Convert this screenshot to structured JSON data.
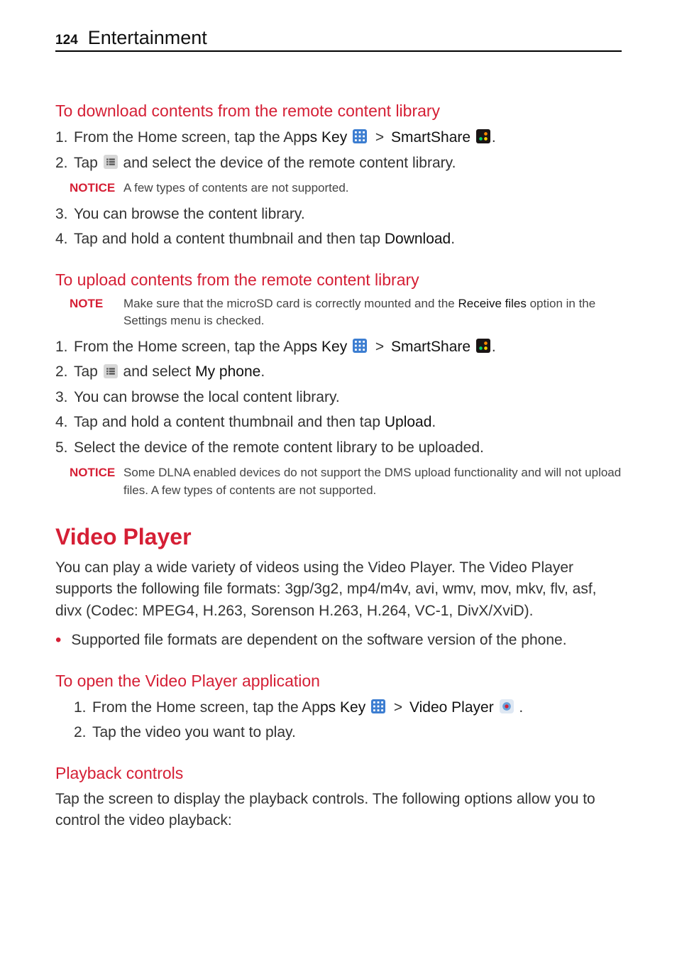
{
  "header": {
    "page_number": "124",
    "title": "Entertainment"
  },
  "sec_download": {
    "heading": "To download contents from the remote content library",
    "step1_a": "From the Home screen, tap the Ap",
    "step1_b": "ps Key",
    "step1_c": "SmartShare",
    "step2_a": "Tap ",
    "step2_b": " and select the device of the remote content library.",
    "notice_label": "NOTICE",
    "notice_text": "A few types of contents are not supported.",
    "step3": "You can browse the content library.",
    "step4_a": "Tap and hold a content thumbnail and then tap ",
    "step4_b": "Download",
    "step4_c": "."
  },
  "sec_upload": {
    "heading": "To upload contents from the remote content library",
    "note_label": "NOTE",
    "note_text_a": "Make sure that the microSD card is correctly mounted and the ",
    "note_text_b": "Receive files",
    "note_text_c": " option in the Settings menu is checked.",
    "step1_a": "From the Home screen, tap the Ap",
    "step1_b": "ps Key",
    "step1_c": "SmartShare",
    "step2_a": "Tap ",
    "step2_b": " and select ",
    "step2_c": "My phone",
    "step2_d": ".",
    "step3": "You can browse the local content library.",
    "step4_a": "Tap and hold a content thumbnail and then tap ",
    "step4_b": "Upload",
    "step4_c": ".",
    "step5": "Select the device of the remote content library to be uploaded.",
    "notice_label": "NOTICE",
    "notice_text": "Some DLNA enabled devices do not support the DMS upload functionality and will not upload files. A few types of contents are not supported."
  },
  "sec_video": {
    "title": "Video Player",
    "intro": "You can play a wide variety of videos using the Video Player. The Video Player supports the following file formats: 3gp/3g2, mp4/m4v, avi, wmv, mov, mkv, flv, asf, divx (Codec: MPEG4, H.263, Sorenson H.263, H.264, VC-1, DivX/XviD).",
    "bullet1": "Supported file formats are dependent on the software version of the phone.",
    "open_heading": "To open the Video Player application",
    "open_step1_a": "From the Home screen, tap the Ap",
    "open_step1_b": "ps Key",
    "open_step1_c": "Video Player",
    "open_step2": "Tap the video you want to play.",
    "playback_heading": "Playback controls",
    "playback_text": "Tap the screen to display the playback controls. The following options allow you to control the video playback:"
  },
  "glyphs": {
    "gt": ">"
  }
}
